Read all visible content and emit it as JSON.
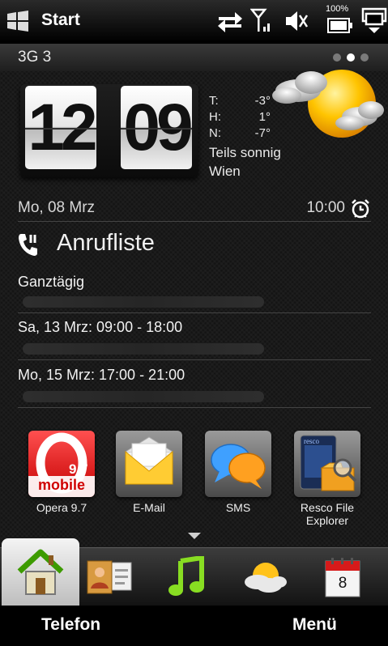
{
  "statusbar": {
    "start_label": "Start",
    "battery_percent": "100%",
    "icons": [
      "windows-logo-icon",
      "data-sync-icon",
      "signal-icon",
      "speaker-muted-icon",
      "battery-icon",
      "display-switch-icon"
    ]
  },
  "carrier": {
    "name": "3G 3",
    "page_count": 3,
    "active_page": 2
  },
  "clock": {
    "hour": "12",
    "minute": "09"
  },
  "weather": {
    "t_label": "T:",
    "t_value": "-3°",
    "h_label": "H:",
    "h_value": "1°",
    "n_label": "N:",
    "n_value": "-7°",
    "condition": "Teils sonnig",
    "city": "Wien",
    "icon": "partly-sunny-icon"
  },
  "date_row": {
    "date": "Mo, 08 Mrz",
    "alarm": "10:00"
  },
  "calls": {
    "title": "Anrufliste"
  },
  "calendar": [
    {
      "when": "Ganztägig"
    },
    {
      "when": "Sa, 13 Mrz: 09:00 - 18:00"
    },
    {
      "when": "Mo, 15 Mrz: 17:00 - 21:00"
    }
  ],
  "apps": [
    {
      "label": "Opera 9.7",
      "badge_version": "9.7",
      "badge_word": "mobile"
    },
    {
      "label": "E-Mail"
    },
    {
      "label": "SMS"
    },
    {
      "label_line1": "Resco File",
      "label_line2": "Explorer",
      "brand": "resco"
    }
  ],
  "tabs": [
    {
      "name": "home",
      "icon": "home-icon",
      "active": true
    },
    {
      "name": "people",
      "icon": "contact-card-icon"
    },
    {
      "name": "music",
      "icon": "music-note-icon"
    },
    {
      "name": "weather",
      "icon": "weather-icon"
    },
    {
      "name": "calendar",
      "icon": "calendar-icon",
      "day": "8"
    }
  ],
  "softkeys": {
    "left": "Telefon",
    "right": "Menü"
  }
}
